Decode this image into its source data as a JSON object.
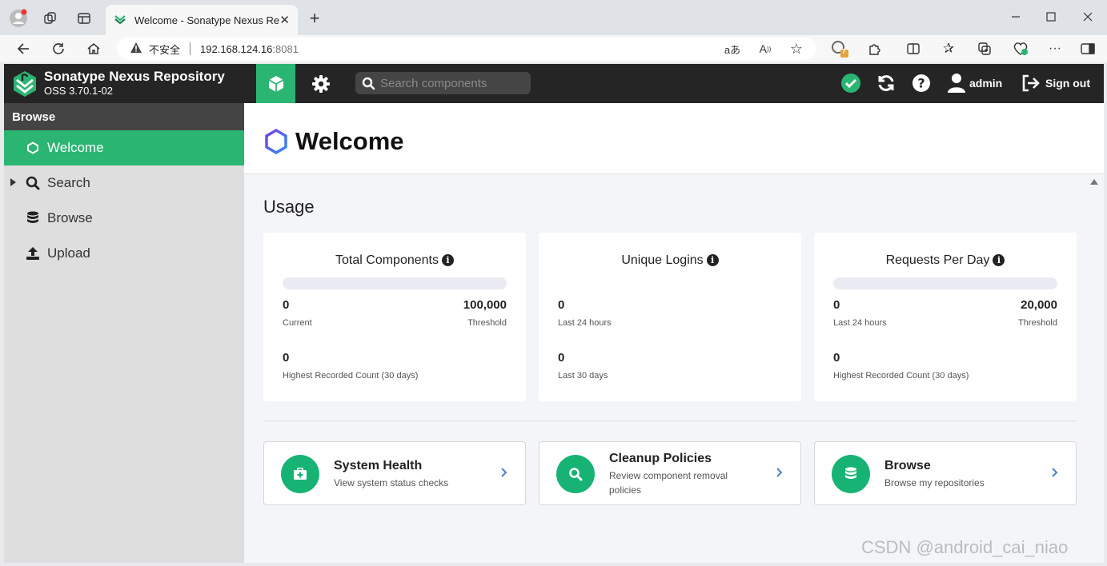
{
  "browser": {
    "tab_title": "Welcome - Sonatype Nexus Repository",
    "security_label": "不安全",
    "url_host": "192.168.124.16",
    "url_port": ":8081",
    "extension_badge": "7"
  },
  "header": {
    "app_name": "Sonatype Nexus Repository",
    "version": "OSS 3.70.1-02",
    "search_placeholder": "Search components",
    "user": "admin",
    "sign_out": "Sign out"
  },
  "sidebar": {
    "heading": "Browse",
    "items": [
      {
        "label": "Welcome",
        "active": true
      },
      {
        "label": "Search",
        "active": false
      },
      {
        "label": "Browse",
        "active": false
      },
      {
        "label": "Upload",
        "active": false
      }
    ]
  },
  "main": {
    "title": "Welcome",
    "usage_title": "Usage",
    "cards": [
      {
        "title": "Total Components",
        "progress": 0,
        "current_value": "0",
        "current_label": "Current",
        "threshold_value": "100,000",
        "threshold_label": "Threshold",
        "secondary_value": "0",
        "secondary_label": "Highest Recorded Count (30 days)"
      },
      {
        "title": "Unique Logins",
        "current_value": "0",
        "current_label": "Last 24 hours",
        "secondary_value": "0",
        "secondary_label": "Last 30 days"
      },
      {
        "title": "Requests Per Day",
        "progress": 0,
        "current_value": "0",
        "current_label": "Last 24 hours",
        "threshold_value": "20,000",
        "threshold_label": "Threshold",
        "secondary_value": "0",
        "secondary_label": "Highest Recorded Count (30 days)"
      }
    ],
    "links": [
      {
        "title": "System Health",
        "desc": "View system status checks"
      },
      {
        "title": "Cleanup Policies",
        "desc": "Review component removal policies"
      },
      {
        "title": "Browse",
        "desc": "Browse my repositories"
      }
    ]
  },
  "watermark": "CSDN @android_cai_niao",
  "colors": {
    "accent": "#2bb572",
    "header_bg": "#252525",
    "sidebar_bg": "#dedede"
  }
}
